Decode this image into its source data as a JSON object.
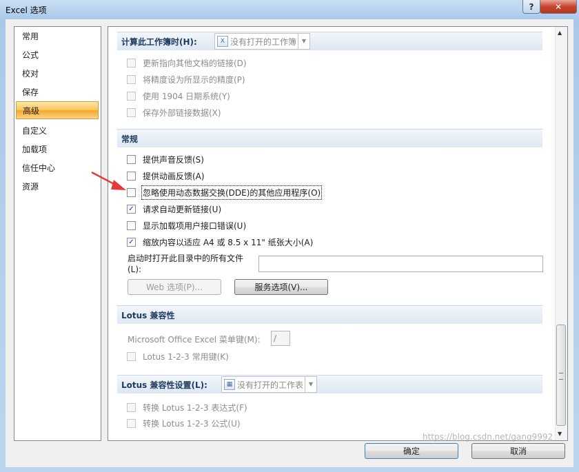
{
  "window": {
    "title": "Excel 选项",
    "help_label": "?",
    "close_label": "✕"
  },
  "sidebar": {
    "items": [
      {
        "label": "常用"
      },
      {
        "label": "公式"
      },
      {
        "label": "校对"
      },
      {
        "label": "保存"
      },
      {
        "label": "高级",
        "selected": true
      },
      {
        "label": "自定义"
      },
      {
        "label": "加载项"
      },
      {
        "label": "信任中心"
      },
      {
        "label": "资源"
      }
    ]
  },
  "calc_section": {
    "title": "计算此工作簿时(H):",
    "workbook_combo": "没有打开的工作簿",
    "options": [
      {
        "label": "更新指向其他文档的链接(D)",
        "checked": false,
        "enabled": false
      },
      {
        "label": "将精度设为所显示的精度(P)",
        "checked": false,
        "enabled": false
      },
      {
        "label": "使用 1904 日期系统(Y)",
        "checked": false,
        "enabled": false
      },
      {
        "label": "保存外部链接数据(X)",
        "checked": false,
        "enabled": false
      }
    ]
  },
  "general_section": {
    "title": "常规",
    "options": [
      {
        "label": "提供声音反馈(S)",
        "checked": false
      },
      {
        "label": "提供动画反馈(A)",
        "checked": false
      },
      {
        "label": "忽略使用动态数据交换(DDE)的其他应用程序(O)",
        "checked": false,
        "focused": true
      },
      {
        "label": "请求自动更新链接(U)",
        "checked": true
      },
      {
        "label": "显示加载项用户接口错误(U)",
        "checked": false
      },
      {
        "label": "缩放内容以适应 A4 或 8.5 x 11\" 纸张大小(A)",
        "checked": true
      }
    ],
    "startup_label_1": "启动时打开此目录中的所有文件",
    "startup_label_2": "(L):",
    "startup_value": "",
    "web_options_button": "Web 选项(P)...",
    "service_options_button": "服务选项(V)..."
  },
  "lotus_section": {
    "title": "Lotus 兼容性",
    "menu_key_label": "Microsoft Office Excel 菜单键(M):",
    "menu_key_value": "/",
    "nav_keys_label": "Lotus 1-2-3 常用键(K)"
  },
  "lotus_settings_section": {
    "title": "Lotus 兼容性设置(L):",
    "sheet_combo": "没有打开的工作表",
    "options": [
      {
        "label": "转换 Lotus 1-2-3 表达式(F)",
        "checked": false,
        "enabled": false
      },
      {
        "label": "转换 Lotus 1-2-3 公式(U)",
        "checked": false,
        "enabled": false
      }
    ]
  },
  "footer": {
    "ok_button": "确定",
    "cancel_button": "取消"
  },
  "watermark": "https://blog.csdn.net/gang9992",
  "colors": {
    "selected_nav": "#fbc85c",
    "annotation_arrow": "#e53935"
  }
}
